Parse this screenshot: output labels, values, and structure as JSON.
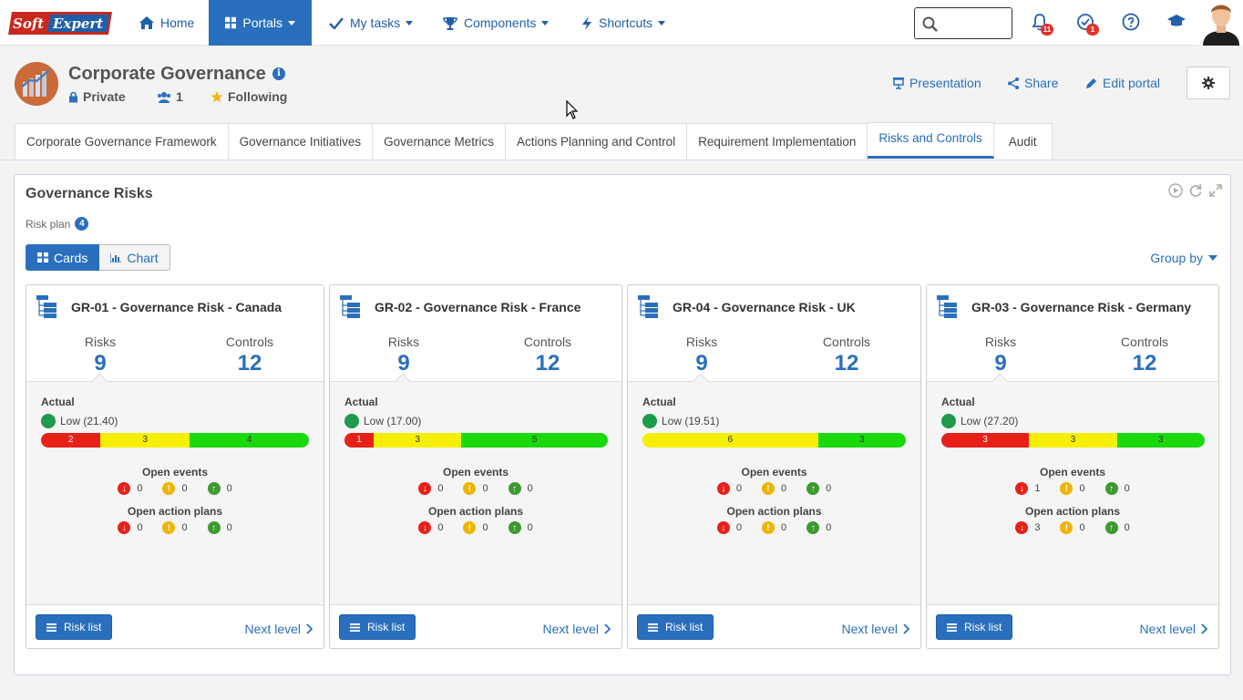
{
  "brand": {
    "logo_text_1": "Soft",
    "logo_text_2": "Expert"
  },
  "nav": {
    "items": [
      {
        "label": "Home",
        "icon": "home-icon"
      },
      {
        "label": "Portals",
        "icon": "grid-icon",
        "active": true
      },
      {
        "label": "My tasks",
        "icon": "check-icon"
      },
      {
        "label": "Components",
        "icon": "trophy-icon"
      },
      {
        "label": "Shortcuts",
        "icon": "bolt-icon"
      }
    ],
    "notifications_count": "11",
    "tasks_count": "1"
  },
  "portal": {
    "title": "Corporate Governance",
    "privacy": "Private",
    "members": "1",
    "following": "Following",
    "actions": {
      "presentation": "Presentation",
      "share": "Share",
      "edit": "Edit portal"
    }
  },
  "tabs": [
    "Corporate Governance Framework",
    "Governance Initiatives",
    "Governance Metrics",
    "Actions Planning and Control",
    "Requirement Implementation",
    "Risks and Controls",
    "Audit"
  ],
  "active_tab": "Risks and Controls",
  "panel": {
    "title": "Governance Risks",
    "risk_plan_label": "Risk plan",
    "risk_plan_count": "4",
    "view_cards": "Cards",
    "view_chart": "Chart",
    "group_by": "Group by"
  },
  "card_labels": {
    "risks": "Risks",
    "controls": "Controls",
    "actual": "Actual",
    "open_events": "Open events",
    "open_action_plans": "Open action plans",
    "risk_list": "Risk list",
    "next_level": "Next level"
  },
  "colors": {
    "accent": "#2a6fbd",
    "red": "#e8201a",
    "yellow": "#f6f000",
    "green": "#19d90c"
  },
  "cards": [
    {
      "title": "GR-01 - Governance Risk - Canada",
      "risks": "9",
      "controls": "12",
      "level": "Low (21.40)",
      "bar": {
        "red": "2",
        "yellow": "3",
        "green": "4"
      },
      "events": {
        "red": "0",
        "yellow": "0",
        "green": "0"
      },
      "plans": {
        "red": "0",
        "yellow": "0",
        "green": "0"
      }
    },
    {
      "title": "GR-02 - Governance Risk - France",
      "risks": "9",
      "controls": "12",
      "level": "Low (17.00)",
      "bar": {
        "red": "1",
        "yellow": "3",
        "green": "5"
      },
      "events": {
        "red": "0",
        "yellow": "0",
        "green": "0"
      },
      "plans": {
        "red": "0",
        "yellow": "0",
        "green": "0"
      }
    },
    {
      "title": "GR-04 - Governance Risk - UK",
      "risks": "9",
      "controls": "12",
      "level": "Low (19.51)",
      "bar": {
        "red": "",
        "yellow": "6",
        "green": "3"
      },
      "events": {
        "red": "0",
        "yellow": "0",
        "green": "0"
      },
      "plans": {
        "red": "0",
        "yellow": "0",
        "green": "0"
      }
    },
    {
      "title": "GR-03 - Governance Risk - Germany",
      "risks": "9",
      "controls": "12",
      "level": "Low (27.20)",
      "bar": {
        "red": "3",
        "yellow": "3",
        "green": "3"
      },
      "events": {
        "red": "1",
        "yellow": "0",
        "green": "0"
      },
      "plans": {
        "red": "3",
        "yellow": "0",
        "green": "0"
      }
    }
  ]
}
